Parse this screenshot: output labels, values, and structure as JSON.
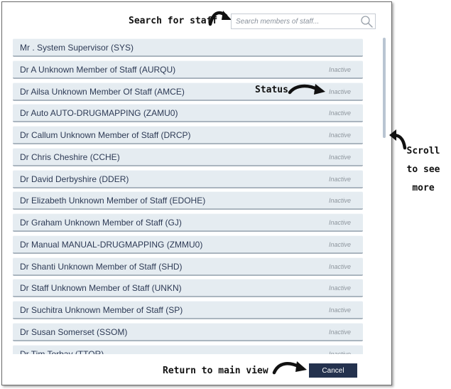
{
  "search": {
    "annotation": "Search for staff",
    "placeholder": "Search members of staff..."
  },
  "staff": [
    {
      "name": "Mr . System Supervisor (SYS)",
      "status": ""
    },
    {
      "name": "Dr A Unknown Member of Staff (AURQU)",
      "status": "Inactive"
    },
    {
      "name": "Dr Ailsa Unknown Member Of Staff (AMCE)",
      "status": "Inactive"
    },
    {
      "name": "Dr Auto AUTO-DRUGMAPPING (ZAMU0)",
      "status": "Inactive"
    },
    {
      "name": "Dr Callum Unknown Member of Staff (DRCP)",
      "status": "Inactive"
    },
    {
      "name": "Dr Chris Cheshire (CCHE)",
      "status": "Inactive"
    },
    {
      "name": "Dr David Derbyshire (DDER)",
      "status": "Inactive"
    },
    {
      "name": "Dr Elizabeth Unknown Member of Staff (EDOHE)",
      "status": "Inactive"
    },
    {
      "name": "Dr Graham Unknown Member of Staff (GJ)",
      "status": "Inactive"
    },
    {
      "name": "Dr Manual MANUAL-DRUGMAPPING (ZMMU0)",
      "status": "Inactive"
    },
    {
      "name": "Dr Shanti Unknown Member of Staff (SHD)",
      "status": "Inactive"
    },
    {
      "name": "Dr Staff Unknown Member of Staff (UNKN)",
      "status": "Inactive"
    },
    {
      "name": "Dr Suchitra Unknown Member of Staff (SP)",
      "status": "Inactive"
    },
    {
      "name": "Dr Susan Somerset (SSOM)",
      "status": "Inactive"
    },
    {
      "name": "Dr Tim Torbay (TTOR)",
      "status": "Inactive"
    }
  ],
  "annotations": {
    "status": "Status",
    "scroll_line1": "Scroll",
    "scroll_line2": "to see",
    "scroll_line3": "more",
    "return": "Return to main view"
  },
  "footer": {
    "cancel_label": "Cancel"
  },
  "colors": {
    "row_background": "#e5ecf1",
    "button_background": "#24324e",
    "scrollbar": "#b9c5d2"
  }
}
